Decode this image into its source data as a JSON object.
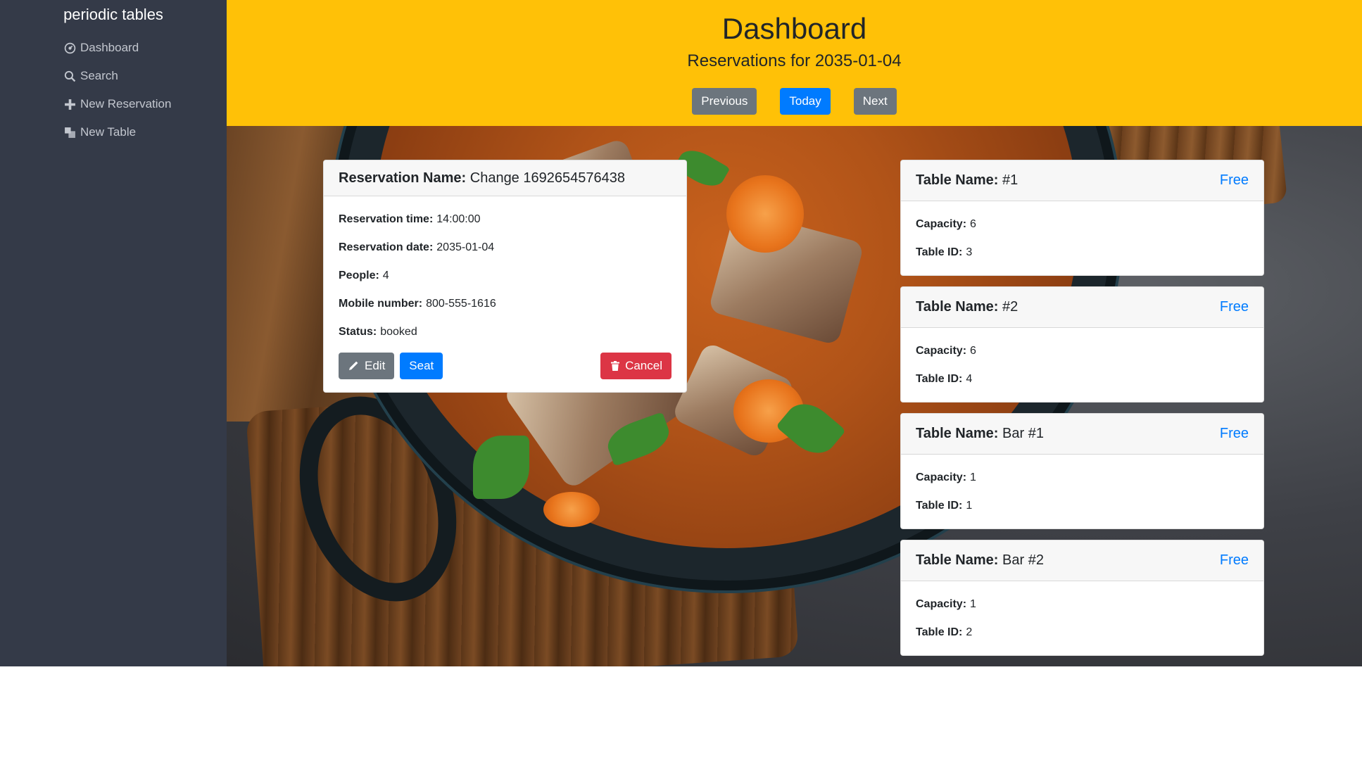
{
  "sidebar": {
    "brand": "periodic tables",
    "items": [
      {
        "label": "Dashboard",
        "icon": "dashboard-icon"
      },
      {
        "label": "Search",
        "icon": "search-icon"
      },
      {
        "label": "New Reservation",
        "icon": "plus-icon"
      },
      {
        "label": "New Table",
        "icon": "table-icon"
      }
    ]
  },
  "header": {
    "title": "Dashboard",
    "subtitle": "Reservations for 2035-01-04",
    "buttons": {
      "previous": "Previous",
      "today": "Today",
      "next": "Next"
    }
  },
  "reservation": {
    "name_label": "Reservation Name:",
    "name": "Change 1692654576438",
    "fields": [
      {
        "label": "Reservation time:",
        "value": "14:00:00"
      },
      {
        "label": "Reservation date:",
        "value": "2035-01-04"
      },
      {
        "label": "People:",
        "value": "4"
      },
      {
        "label": "Mobile number:",
        "value": "800-555-1616"
      },
      {
        "label": "Status:",
        "value": "booked"
      }
    ],
    "actions": {
      "edit": "Edit",
      "seat": "Seat",
      "cancel": "Cancel"
    }
  },
  "tables": [
    {
      "name_label": "Table Name:",
      "name": "#1",
      "status": "Free",
      "capacity_label": "Capacity:",
      "capacity": "6",
      "id_label": "Table ID:",
      "id": "3"
    },
    {
      "name_label": "Table Name:",
      "name": "#2",
      "status": "Free",
      "capacity_label": "Capacity:",
      "capacity": "6",
      "id_label": "Table ID:",
      "id": "4"
    },
    {
      "name_label": "Table Name:",
      "name": "Bar #1",
      "status": "Free",
      "capacity_label": "Capacity:",
      "capacity": "1",
      "id_label": "Table ID:",
      "id": "1"
    },
    {
      "name_label": "Table Name:",
      "name": "Bar #2",
      "status": "Free",
      "capacity_label": "Capacity:",
      "capacity": "1",
      "id_label": "Table ID:",
      "id": "2"
    }
  ],
  "colors": {
    "sidebar_bg": "#343a48",
    "header_bg": "#ffc107",
    "primary": "#007bff",
    "secondary": "#6c757d",
    "danger": "#dc3545"
  }
}
